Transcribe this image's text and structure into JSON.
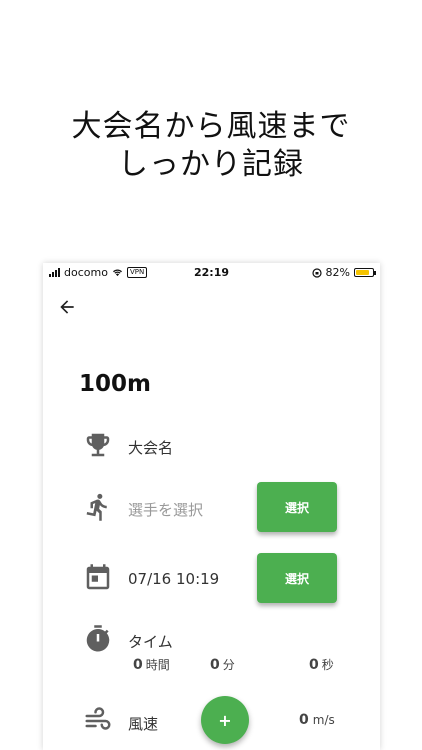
{
  "headline": {
    "line1": "大会名から風速まで",
    "line2": "しっかり記録"
  },
  "status_bar": {
    "carrier": "docomo",
    "vpn": "VPN",
    "time": "22:19",
    "battery": "82%",
    "battery_level": 0.82
  },
  "screen": {
    "title": "100m",
    "tournament": {
      "label": "大会名"
    },
    "player": {
      "placeholder": "選手を選択",
      "button": "選択"
    },
    "datetime": {
      "value": "07/16 10:19",
      "button": "選択"
    },
    "time": {
      "label": "タイム",
      "hours": "0",
      "hours_unit": "時間",
      "minutes": "0",
      "minutes_unit": "分",
      "seconds": "0",
      "seconds_unit": "秒"
    },
    "wind": {
      "label": "風速",
      "add_button": "+",
      "value": "0",
      "unit": "m/s"
    }
  },
  "colors": {
    "accent": "#4caf50",
    "icon": "#5f5f5f",
    "battery": "#f5c400"
  }
}
